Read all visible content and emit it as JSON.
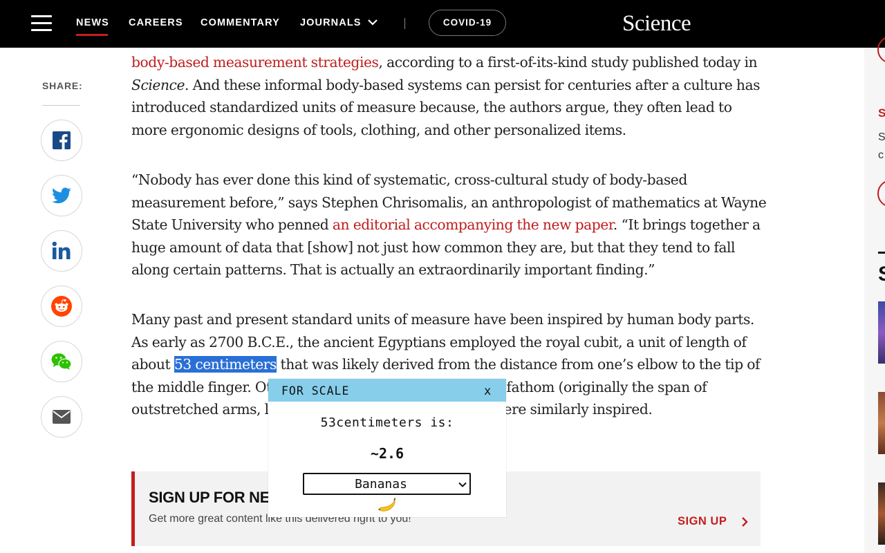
{
  "nav": {
    "items": [
      "NEWS",
      "CAREERS",
      "COMMENTARY",
      "JOURNALS"
    ],
    "covid_label": "COVID-19",
    "logo": "Science",
    "active": "NEWS"
  },
  "share": {
    "label": "SHARE:",
    "buttons": [
      "facebook-icon",
      "twitter-icon",
      "linkedin-icon",
      "reddit-icon",
      "wechat-icon",
      "email-icon"
    ]
  },
  "article": {
    "p1_link": "body-based measurement strategies",
    "p1_text_a": ", according to a first-of-its-kind study published today in ",
    "p1_italic": "Science",
    "p1_text_b": ". And these informal body-based systems can persist for centuries after a culture has introduced standardized units of measure because, the authors argue, they often lead to more ergonomic designs of tools, clothing, and other personalized items.",
    "p2_text_a": "“Nobody has ever done this kind of systematic, cross-cultural study of body-based measurement before,” says Stephen Chrisomalis, an anthropologist of mathematics at Wayne State University who penned ",
    "p2_link": "an editorial accompanying the new paper",
    "p2_text_b": ". “It brings together a huge amount of data that [show] not just how common they are, but that they tend to fall along certain patterns. That is actually an extraordinarily important finding.”",
    "p3_text_a": "Many past and present standard units of measure have been inspired by human body parts. As early as 2700 B.C.E., the ancient Egyptians employed the royal cubit, a unit of length of about ",
    "p3_highlight": "53 centimeters",
    "p3_text_b": " that was likely derived from the distance from one’s elbow to the tip of the middle finger. Other units, such as the foot and the fathom (originally the span of outstretched arms, later standardized to 1.8 meters) were similarly inspired."
  },
  "signup": {
    "title": "SIGN UP FOR NEWS FROM SCIENCE HEADLINES",
    "subtitle": "Get more great content like this delivered right to you!",
    "cta": "SIGN UP"
  },
  "rail": {
    "s_red": "S",
    "s1": "S",
    "c1": "c",
    "s2": "S"
  },
  "popup": {
    "title": "FOR SCALE",
    "close": "x",
    "question": "53centimeters is:",
    "value": "~2.6",
    "selected_unit": "Bananas",
    "header_color": "#87ceeb",
    "emoji": "banana-icon"
  },
  "colors": {
    "accent_red": "#c41e1e",
    "highlight": "#2a6fd6"
  }
}
